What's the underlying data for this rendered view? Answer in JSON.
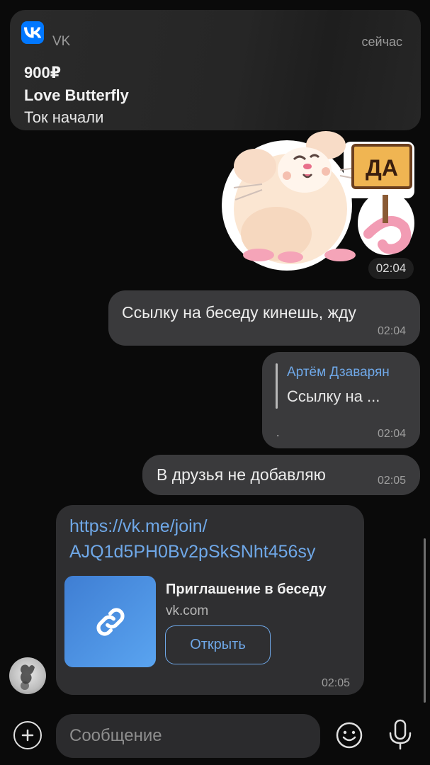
{
  "notification": {
    "app_name": "VK",
    "app_icon": "vk-logo-icon",
    "time": "сейчас",
    "price": "900₽",
    "title": "Love Butterfly",
    "body": "Ток начали"
  },
  "sticker": {
    "sign_text": "ДА",
    "time": "02:04"
  },
  "messages": [
    {
      "text": "Ссылку на беседу кинешь, жду",
      "time": "02:04"
    },
    {
      "reply_author": "Артём Дзаварян",
      "reply_text": "Ссылку на ...",
      "text": ".",
      "time": "02:04"
    },
    {
      "text": "В друзья не добавляю",
      "time": "02:05"
    }
  ],
  "link_message": {
    "url_line1": "https://vk.me/join/",
    "url_line2": "AJQ1d5PH0Bv2pSkSNht456sy",
    "preview_title": "Приглашение в беседу",
    "preview_domain": "vk.com",
    "open_label": "Открыть",
    "time": "02:05",
    "thumb_icon": "link-icon"
  },
  "composer": {
    "placeholder": "Сообщение"
  },
  "colors": {
    "background": "#0a0a0a",
    "bubble": "#3a3a3c",
    "accent": "#6fa8e8",
    "vk_blue": "#0077ff"
  }
}
